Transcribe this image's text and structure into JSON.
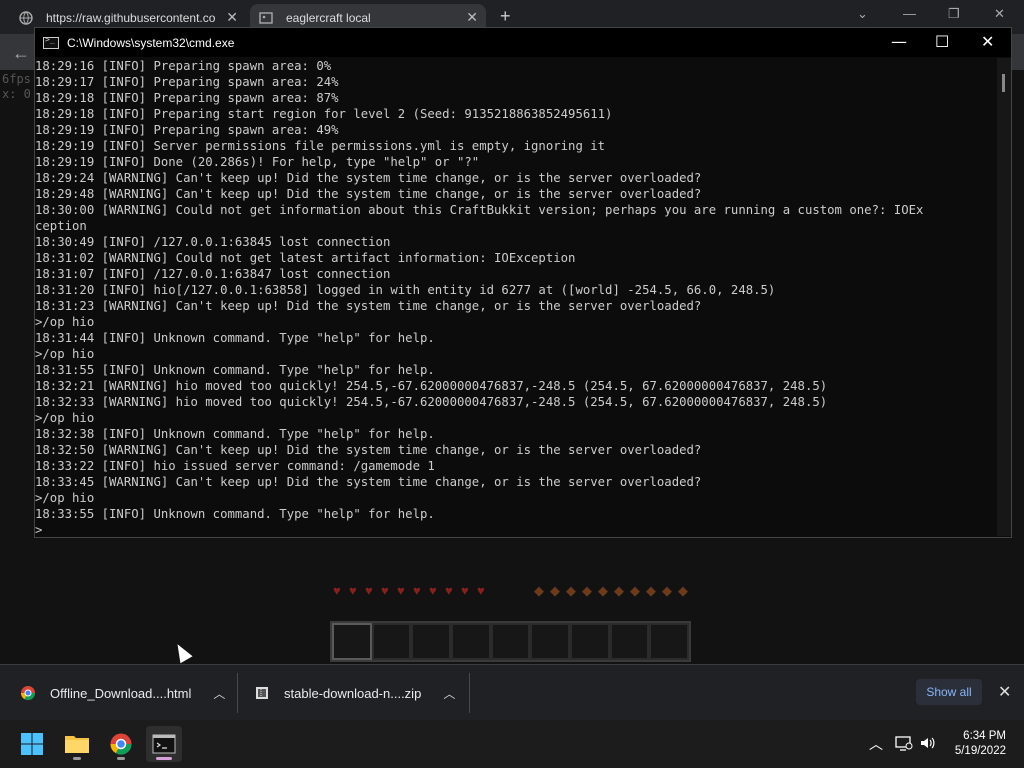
{
  "browser": {
    "tabs": [
      {
        "title": "https://raw.githubusercontent.co"
      },
      {
        "title": "eaglercraft local"
      }
    ]
  },
  "game": {
    "debug_text": [
      "6fps",
      "x: 0"
    ]
  },
  "cmd": {
    "title": "C:\\Windows\\system32\\cmd.exe",
    "lines": [
      "18:29:16 [INFO] Preparing spawn area: 0%",
      "18:29:17 [INFO] Preparing spawn area: 24%",
      "18:29:18 [INFO] Preparing spawn area: 87%",
      "18:29:18 [INFO] Preparing start region for level 2 (Seed: 9135218863852495611)",
      "18:29:19 [INFO] Preparing spawn area: 49%",
      "18:29:19 [INFO] Server permissions file permissions.yml is empty, ignoring it",
      "18:29:19 [INFO] Done (20.286s)! For help, type \"help\" or \"?\"",
      "18:29:24 [WARNING] Can't keep up! Did the system time change, or is the server overloaded?",
      "18:29:48 [WARNING] Can't keep up! Did the system time change, or is the server overloaded?",
      "18:30:00 [WARNING] Could not get information about this CraftBukkit version; perhaps you are running a custom one?: IOEx",
      "ception",
      "18:30:49 [INFO] /127.0.0.1:63845 lost connection",
      "18:31:02 [WARNING] Could not get latest artifact information: IOException",
      "18:31:07 [INFO] /127.0.0.1:63847 lost connection",
      "18:31:20 [INFO] hio[/127.0.0.1:63858] logged in with entity id 6277 at ([world] -254.5, 66.0, 248.5)",
      "18:31:23 [WARNING] Can't keep up! Did the system time change, or is the server overloaded?",
      ">/op hio",
      "18:31:44 [INFO] Unknown command. Type \"help\" for help.",
      ">/op hio",
      "18:31:55 [INFO] Unknown command. Type \"help\" for help.",
      "18:32:21 [WARNING] hio moved too quickly! 254.5,-67.62000000476837,-248.5 (254.5, 67.62000000476837, 248.5)",
      "18:32:33 [WARNING] hio moved too quickly! 254.5,-67.62000000476837,-248.5 (254.5, 67.62000000476837, 248.5)",
      ">/op hio",
      "18:32:38 [INFO] Unknown command. Type \"help\" for help.",
      "18:32:50 [WARNING] Can't keep up! Did the system time change, or is the server overloaded?",
      "18:33:22 [INFO] hio issued server command: /gamemode 1",
      "18:33:45 [WARNING] Can't keep up! Did the system time change, or is the server overloaded?",
      ">/op hio",
      "18:33:55 [INFO] Unknown command. Type \"help\" for help.",
      ">"
    ]
  },
  "downloads": {
    "items": [
      {
        "name": "Offline_Download....html",
        "icon": "chrome-icon"
      },
      {
        "name": "stable-download-n....zip",
        "icon": "zip-file-icon"
      }
    ],
    "show_all_label": "Show all"
  },
  "taskbar": {
    "time": "6:34 PM",
    "date": "5/19/2022"
  },
  "colors": {
    "console_bg": "#0c0c0c",
    "console_text": "#cccccc",
    "link_blue": "#8ab4f8"
  }
}
